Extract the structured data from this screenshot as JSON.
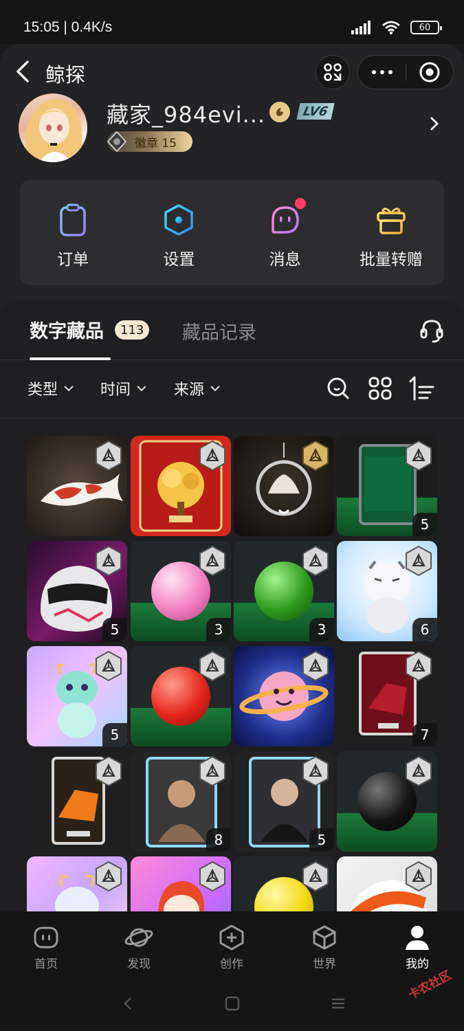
{
  "status_bar": {
    "time": "15:05 | 0.4K/s",
    "battery": "60"
  },
  "nav": {
    "title": "鲸探"
  },
  "profile": {
    "username": "藏家_984evi...",
    "level": "LV6",
    "medal_label": "徽章 15"
  },
  "quick_actions": [
    {
      "label": "订单",
      "icon": "clipboard-icon"
    },
    {
      "label": "设置",
      "icon": "hexagon-settings-icon"
    },
    {
      "label": "消息",
      "icon": "message-face-icon"
    },
    {
      "label": "批量转赠",
      "icon": "gift-icon"
    }
  ],
  "tabs": {
    "active_label": "数字藏品",
    "active_count": "113",
    "other_label": "藏品记录"
  },
  "filters": [
    {
      "label": "类型"
    },
    {
      "label": "时间"
    },
    {
      "label": "来源"
    }
  ],
  "collection": [
    {
      "name": "koi-fish",
      "count": ""
    },
    {
      "name": "money-tree-poster",
      "count": ""
    },
    {
      "name": "lotus-pendant",
      "count": ""
    },
    {
      "name": "snooker-table-card",
      "count": "5"
    },
    {
      "name": "racing-helmet",
      "count": "5"
    },
    {
      "name": "pink-ball",
      "count": "3"
    },
    {
      "name": "green-ball",
      "count": "3"
    },
    {
      "name": "white-tiger",
      "count": "6"
    },
    {
      "name": "jade-dragon",
      "count": "5"
    },
    {
      "name": "red-ball",
      "count": ""
    },
    {
      "name": "planet-smile",
      "count": ""
    },
    {
      "name": "f1-card-red",
      "count": "7"
    },
    {
      "name": "f1-card-orange",
      "count": ""
    },
    {
      "name": "player-card-a",
      "count": "8"
    },
    {
      "name": "player-card-b",
      "count": "5"
    },
    {
      "name": "black-ball",
      "count": ""
    },
    {
      "name": "baby-dragon",
      "count": ""
    },
    {
      "name": "red-hair-character",
      "count": ""
    },
    {
      "name": "yellow-ball",
      "count": ""
    },
    {
      "name": "orange-helmet",
      "count": ""
    }
  ],
  "tab_bar": [
    {
      "label": "首页",
      "icon": "home-icon",
      "active": false
    },
    {
      "label": "发现",
      "icon": "planet-icon",
      "active": false
    },
    {
      "label": "创作",
      "icon": "create-plus-icon",
      "active": false
    },
    {
      "label": "世界",
      "icon": "cube-icon",
      "active": false
    },
    {
      "label": "我的",
      "icon": "user-icon",
      "active": true
    }
  ],
  "watermark": "卡农社区",
  "colors": {
    "accent_dot": "#ff3e67",
    "count_badge": "#f6e9d2",
    "medal_gold": "#efd59c"
  }
}
